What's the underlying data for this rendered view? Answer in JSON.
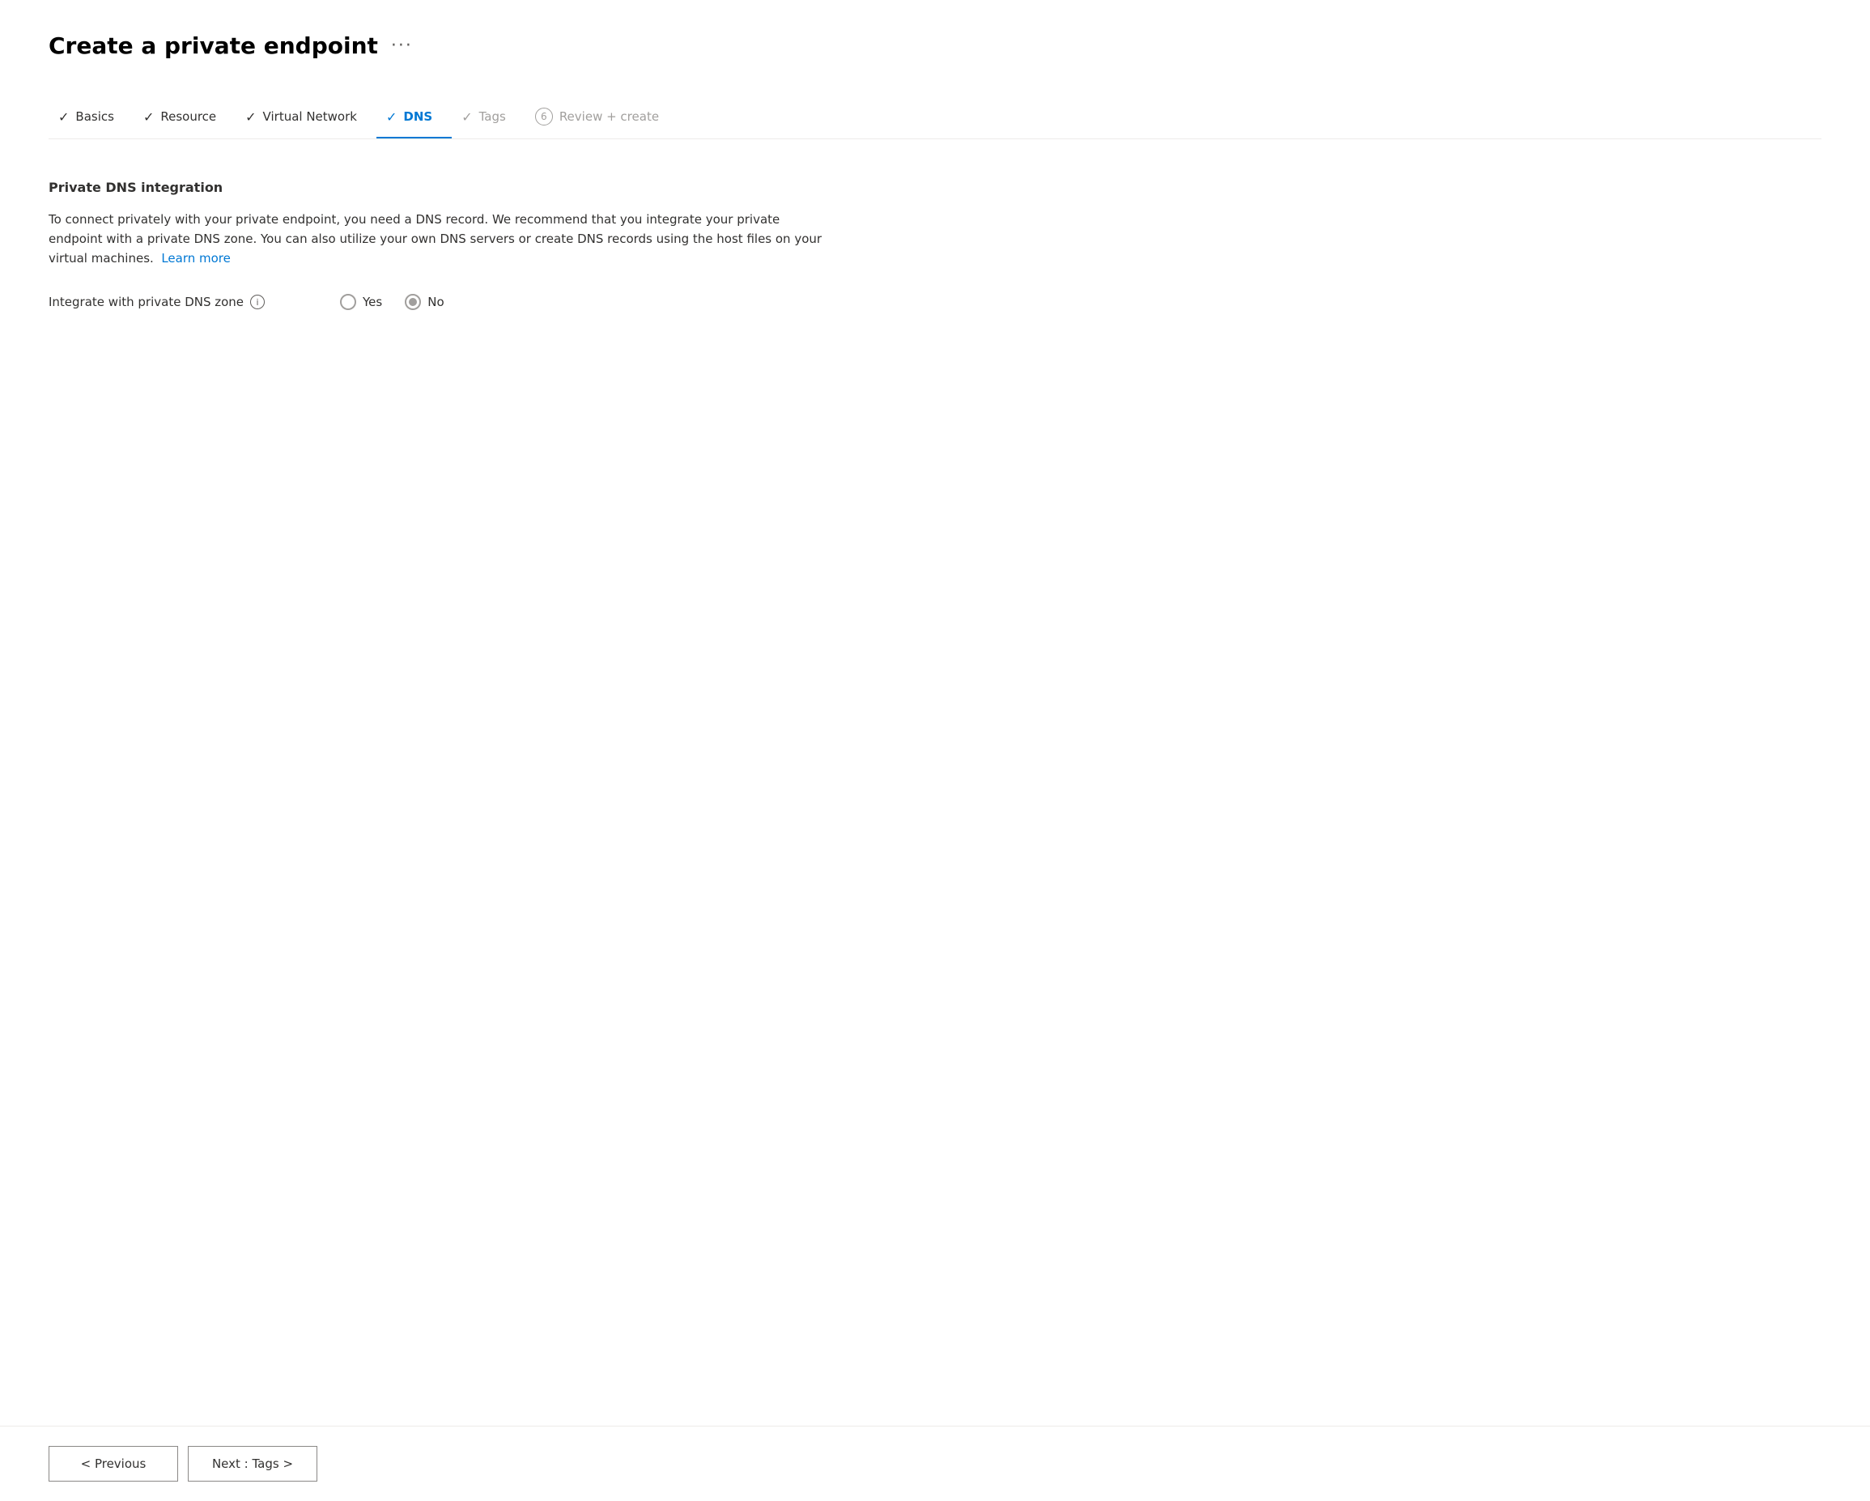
{
  "page": {
    "title": "Create a private endpoint",
    "title_more": "···"
  },
  "wizard": {
    "steps": [
      {
        "id": "basics",
        "label": "Basics",
        "state": "completed",
        "prefix": "✓"
      },
      {
        "id": "resource",
        "label": "Resource",
        "state": "completed",
        "prefix": "✓"
      },
      {
        "id": "virtual-network",
        "label": "Virtual Network",
        "state": "completed",
        "prefix": "✓"
      },
      {
        "id": "dns",
        "label": "DNS",
        "state": "active",
        "prefix": "✓"
      },
      {
        "id": "tags",
        "label": "Tags",
        "state": "disabled",
        "prefix": "✓"
      },
      {
        "id": "review-create",
        "label": "Review + create",
        "state": "disabled",
        "number": "6"
      }
    ]
  },
  "content": {
    "section_title": "Private DNS integration",
    "description_line1": "To connect privately with your private endpoint, you need a DNS record. We recommend that you integrate your private",
    "description_line2": "endpoint with a private DNS zone. You can also utilize your own DNS servers or create DNS records using the host files on your",
    "description_line3": "virtual machines.",
    "learn_more": "Learn more",
    "field_label": "Integrate with private DNS zone",
    "info_icon_label": "i",
    "radio_yes": "Yes",
    "radio_no": "No",
    "selected_option": "no"
  },
  "footer": {
    "previous_label": "< Previous",
    "next_label": "Next : Tags >"
  }
}
